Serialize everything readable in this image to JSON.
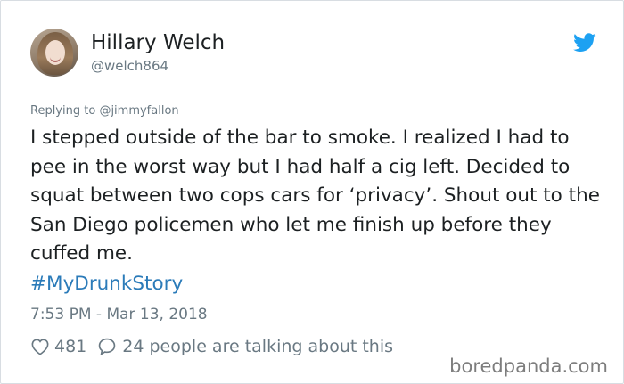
{
  "author": {
    "display_name": "Hillary Welch",
    "handle": "@welch864"
  },
  "reply_context": {
    "prefix": "Replying to ",
    "mention": "@jimmyfallon"
  },
  "tweet": {
    "text": "I stepped outside of the bar to smoke. I realized I had to pee in the worst way but I had half a cig left. Decided to squat between two cops cars for ‘privacy’. Shout out to the San Diego policemen who let me finish up before they cuffed me.",
    "hashtag": "#MyDrunkStory",
    "timestamp": "7:53 PM - Mar 13, 2018"
  },
  "engagement": {
    "likes": "481",
    "talking": "24 people are talking about this"
  },
  "icons": {
    "brand": "twitter-bird-icon",
    "like": "heart-icon",
    "reply": "speech-bubble-icon"
  },
  "colors": {
    "twitter_blue": "#1da1f2",
    "hashtag": "#2b7bb9",
    "text": "#1c2022",
    "muted": "#697882"
  },
  "watermark": "boredpanda.com"
}
